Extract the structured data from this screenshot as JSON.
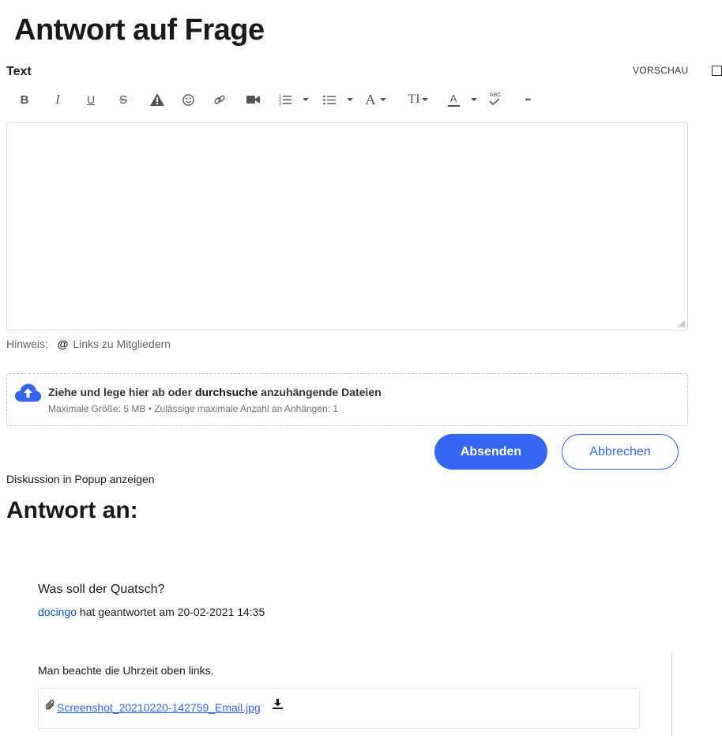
{
  "page": {
    "title": "Antwort auf Frage"
  },
  "editor": {
    "field_label": "Text",
    "preview_label": "VORSCHAU",
    "toolbar": [
      {
        "name": "bold-button",
        "icon": "bold-icon",
        "glyph": "B"
      },
      {
        "name": "italic-button",
        "icon": "italic-icon",
        "glyph": "I"
      },
      {
        "name": "underline-button",
        "icon": "underline-icon",
        "glyph": "U"
      },
      {
        "name": "strikethrough-button",
        "icon": "strikethrough-icon",
        "glyph": "S"
      },
      {
        "name": "spoiler-button",
        "icon": "warning-icon"
      },
      {
        "name": "emoji-button",
        "icon": "smiley-icon"
      },
      {
        "name": "link-button",
        "icon": "link-icon"
      },
      {
        "name": "video-button",
        "icon": "video-icon"
      },
      {
        "name": "numbered-list-button",
        "icon": "numbered-list-icon"
      },
      {
        "name": "bullet-list-button",
        "icon": "bullet-list-icon"
      },
      {
        "name": "font-family-button",
        "icon": "font-icon",
        "glyph": "A"
      },
      {
        "name": "font-size-button",
        "icon": "font-size-icon",
        "glyph": "TI"
      },
      {
        "name": "font-color-button",
        "icon": "font-color-icon",
        "glyph": "A"
      },
      {
        "name": "spellcheck-button",
        "icon": "spellcheck-icon",
        "glyph": "ABC"
      },
      {
        "name": "more-button",
        "icon": "more-icon",
        "glyph": "•••"
      }
    ],
    "value": "",
    "hint_label": "Hinweis:",
    "hint_at": "@",
    "hint_text": "Links zu Mitgliedern"
  },
  "upload": {
    "icon": "cloud-upload-icon",
    "text_before": "Ziehe und lege hier ab oder ",
    "browse_link": "durchsuche",
    "text_after": " anzuhängende Dateien",
    "limits": "Maximale Größe: 5 MB • Zulässige maximale Anzahl an Anhängen: 1"
  },
  "actions": {
    "submit": "Absenden",
    "cancel": "Abbrechen"
  },
  "popup_link": "Diskussion in Popup anzeigen",
  "reply_to": {
    "heading": "Antwort an:",
    "post": {
      "title": "Was soll der Quatsch?",
      "author": "docingo",
      "meta_text": " hat geantwortet am ",
      "date": "20-02-2021 14:35",
      "body": "Man beachte die Uhrzeit oben links.",
      "attachment": {
        "filename": "Screenshot_20210220-142759_Email.jpg",
        "icon": "paperclip-icon",
        "download_icon": "download-icon"
      }
    }
  },
  "colors": {
    "accent": "#3665f3",
    "link": "#0654ba",
    "text": "#191919",
    "muted": "#707070"
  }
}
